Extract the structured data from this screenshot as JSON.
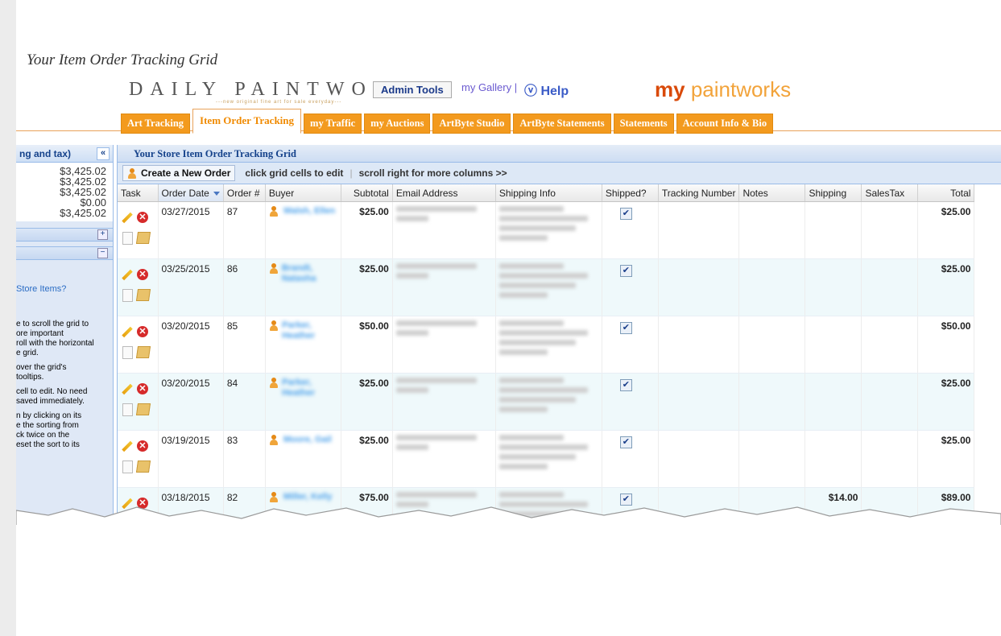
{
  "caption": "Your Item Order Tracking Grid",
  "header": {
    "brand": "DAILY PAINTWORKS",
    "tagline": "---new original fine art for sale everyday---",
    "admin_tools": "Admin Tools",
    "my_gallery": "my Gallery |",
    "help": "ⓥ Help",
    "my_logo_prefix": "my",
    "my_logo_text": "paintworks"
  },
  "tabs": [
    {
      "label": "Art Tracking",
      "active": false
    },
    {
      "label": "Item Order Tracking",
      "active": true
    },
    {
      "label": "my Traffic",
      "active": false
    },
    {
      "label": "my Auctions",
      "active": false
    },
    {
      "label": "ArtByte Studio",
      "active": false
    },
    {
      "label": "ArtByte Statements",
      "active": false
    },
    {
      "label": "Statements",
      "active": false
    },
    {
      "label": "Account Info & Bio",
      "active": false
    }
  ],
  "left_panel": {
    "title": "ng and tax)",
    "collapse": "«",
    "amounts": [
      "$3,425.02",
      "$3,425.02",
      "$3,425.02",
      "$0.00",
      "$3,425.02"
    ],
    "expand": "+",
    "collapse_section": "−",
    "store_link": "Store Items?",
    "help": [
      "e to scroll the grid to",
      "ore important",
      "roll with the horizontal",
      "e grid.",
      "over the grid's",
      "tooltips.",
      "cell to edit. No need",
      "saved immediately.",
      "n by clicking on its",
      "e the sorting from",
      "ck twice on the",
      "eset the sort to its"
    ]
  },
  "grid": {
    "title": "Your Store Item Order Tracking Grid",
    "create_button": "Create a New Order",
    "note1": "click grid cells to edit",
    "note2": "scroll right for more columns >>",
    "columns": [
      "Task",
      "Order Date",
      "Order #",
      "Buyer",
      "Subtotal",
      "Email Address",
      "Shipping Info",
      "Shipped?",
      "Tracking Number",
      "Notes",
      "Shipping",
      "SalesTax",
      "Total"
    ],
    "rows": [
      {
        "date": "03/27/2015",
        "order": "87",
        "buyer": "Walsh, Ellen",
        "subtotal": "$25.00",
        "shipped": "✔",
        "shipping": "",
        "salestax": "",
        "total": "$25.00"
      },
      {
        "date": "03/25/2015",
        "order": "86",
        "buyer": "Brandt, Natasha",
        "subtotal": "$25.00",
        "shipped": "✔",
        "shipping": "",
        "salestax": "",
        "total": "$25.00"
      },
      {
        "date": "03/20/2015",
        "order": "85",
        "buyer": "Parker, Heather",
        "subtotal": "$50.00",
        "shipped": "✔",
        "shipping": "",
        "salestax": "",
        "total": "$50.00"
      },
      {
        "date": "03/20/2015",
        "order": "84",
        "buyer": "Parker, Heather",
        "subtotal": "$25.00",
        "shipped": "✔",
        "shipping": "",
        "salestax": "",
        "total": "$25.00"
      },
      {
        "date": "03/19/2015",
        "order": "83",
        "buyer": "Moore, Gail",
        "subtotal": "$25.00",
        "shipped": "✔",
        "shipping": "",
        "salestax": "",
        "total": "$25.00"
      },
      {
        "date": "03/18/2015",
        "order": "82",
        "buyer": "Miller, Kelly",
        "subtotal": "$75.00",
        "shipped": "✔",
        "shipping": "$14.00",
        "salestax": "",
        "total": "$89.00"
      }
    ]
  }
}
